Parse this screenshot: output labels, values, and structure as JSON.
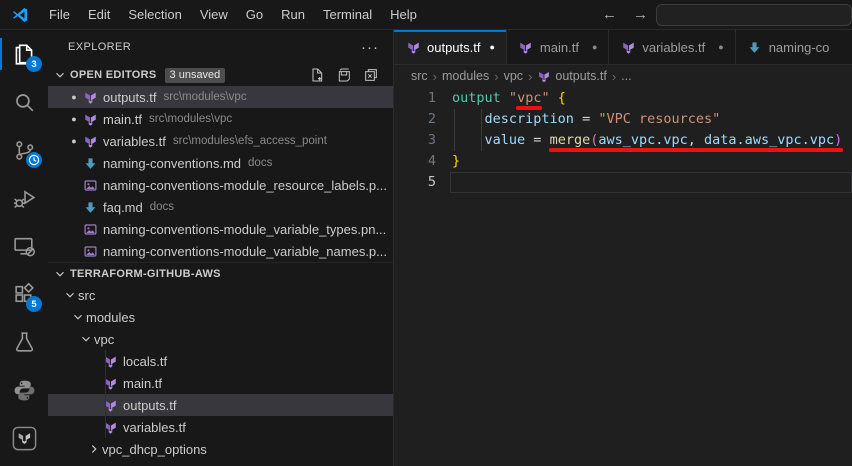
{
  "titlebar": {
    "menus": [
      "File",
      "Edit",
      "Selection",
      "View",
      "Go",
      "Run",
      "Terminal",
      "Help"
    ],
    "back_arrow": "←",
    "forward_arrow": "→",
    "search_value": "",
    "search_placeholder": ""
  },
  "activitybar": {
    "items": [
      {
        "name": "explorer",
        "badge": "3",
        "active": true
      },
      {
        "name": "search",
        "active": false
      },
      {
        "name": "source-control",
        "badge": "clock",
        "active": false
      },
      {
        "name": "run-and-debug",
        "active": false
      },
      {
        "name": "remote-explorer",
        "active": false
      },
      {
        "name": "extensions",
        "badge": "5",
        "active": false
      },
      {
        "name": "testing",
        "active": false
      },
      {
        "name": "python",
        "active": false
      },
      {
        "name": "terraform",
        "active": false
      }
    ]
  },
  "sidebar": {
    "title": "EXPLORER",
    "open_editors": {
      "label": "OPEN EDITORS",
      "badge": "3 unsaved",
      "actions": [
        "new-file",
        "save-all",
        "close-all"
      ],
      "items": [
        {
          "modified": true,
          "icon": "terraform",
          "name": "outputs.tf",
          "path": "src\\modules\\vpc",
          "selected": true
        },
        {
          "modified": true,
          "icon": "terraform",
          "name": "main.tf",
          "path": "src\\modules\\vpc",
          "selected": false
        },
        {
          "modified": true,
          "icon": "terraform",
          "name": "variables.tf",
          "path": "src\\modules\\efs_access_point",
          "selected": false
        },
        {
          "modified": false,
          "icon": "markdown",
          "name": "naming-conventions.md",
          "path": "docs",
          "selected": false
        },
        {
          "modified": false,
          "icon": "image",
          "name": "naming-conventions-module_resource_labels.p...",
          "path": "",
          "selected": false
        },
        {
          "modified": false,
          "icon": "markdown",
          "name": "faq.md",
          "path": "docs",
          "selected": false
        },
        {
          "modified": false,
          "icon": "image",
          "name": "naming-conventions-module_variable_types.pn...",
          "path": "",
          "selected": false
        },
        {
          "modified": false,
          "icon": "image",
          "name": "naming-conventions-module_variable_names.p...",
          "path": "",
          "selected": false
        }
      ]
    },
    "project": {
      "label": "TERRAFORM-GITHUB-AWS",
      "tree": [
        {
          "label": "src",
          "chevron": "down",
          "indent": 14,
          "icon": null,
          "selected": false
        },
        {
          "label": "modules",
          "chevron": "down",
          "indent": 22,
          "icon": null,
          "selected": false
        },
        {
          "label": "vpc",
          "chevron": "down",
          "indent": 30,
          "icon": null,
          "selected": false
        },
        {
          "label": "locals.tf",
          "chevron": null,
          "indent": 54,
          "icon": "terraform",
          "selected": false
        },
        {
          "label": "main.tf",
          "chevron": null,
          "indent": 54,
          "icon": "terraform",
          "selected": false
        },
        {
          "label": "outputs.tf",
          "chevron": null,
          "indent": 54,
          "icon": "terraform",
          "selected": true
        },
        {
          "label": "variables.tf",
          "chevron": null,
          "indent": 54,
          "icon": "terraform",
          "selected": false
        },
        {
          "label": "vpc_dhcp_options",
          "chevron": "right",
          "indent": 38,
          "icon": null,
          "selected": false
        }
      ]
    }
  },
  "editor": {
    "tabs": [
      {
        "icon": "terraform",
        "label": "outputs.tf",
        "dot": true,
        "active": true
      },
      {
        "icon": "terraform",
        "label": "main.tf",
        "dot": true,
        "active": false
      },
      {
        "icon": "terraform",
        "label": "variables.tf",
        "dot": true,
        "active": false
      },
      {
        "icon": "markdown",
        "label": "naming-co",
        "dot": false,
        "active": false
      }
    ],
    "breadcrumb": [
      {
        "label": "src",
        "icon": null
      },
      {
        "label": "modules",
        "icon": null
      },
      {
        "label": "vpc",
        "icon": null
      },
      {
        "label": "outputs.tf",
        "icon": "terraform"
      },
      {
        "label": "...",
        "icon": null
      }
    ],
    "code": {
      "lines": [
        {
          "num": "1",
          "current": false,
          "tokens": [
            [
              "output",
              "type"
            ],
            [
              " ",
              "pl"
            ],
            [
              "\"",
              "str"
            ],
            [
              "vpc",
              "str u"
            ],
            [
              "\"",
              "str"
            ],
            [
              " ",
              "pl"
            ],
            [
              "{",
              "b1"
            ]
          ]
        },
        {
          "num": "2",
          "current": false,
          "tokens": [
            [
              "    ",
              "pl"
            ],
            [
              "description",
              "prop"
            ],
            [
              " ",
              "pl"
            ],
            [
              "=",
              "op"
            ],
            [
              " ",
              "pl"
            ],
            [
              "\"VPC resources\"",
              "str"
            ]
          ]
        },
        {
          "num": "3",
          "current": false,
          "tokens": [
            [
              "    ",
              "pl"
            ],
            [
              "value",
              "prop"
            ],
            [
              " ",
              "pl"
            ],
            [
              "=",
              "op"
            ],
            [
              " ",
              "pl"
            ],
            [
              "merge",
              "fn u"
            ],
            [
              "(",
              "b2 u"
            ],
            [
              "aws_vpc.vpc",
              "prop u"
            ],
            [
              ",",
              "op u"
            ],
            [
              " ",
              "pl u"
            ],
            [
              "data.aws_vpc.vpc",
              "prop u"
            ],
            [
              ")",
              "b2 u"
            ]
          ]
        },
        {
          "num": "4",
          "current": false,
          "tokens": [
            [
              "}",
              "b1"
            ]
          ]
        },
        {
          "num": "5",
          "current": true,
          "tokens": []
        }
      ],
      "annotations": "red underlines on \"vpc\" and merge(aws_vpc.vpc, data.aws_vpc.vpc)"
    }
  },
  "colors": {
    "accent": "#0078d4",
    "red": "#ed1111",
    "tfPurpleDark": "#8a63c4",
    "tfPurpleLight": "#b08ae0",
    "mdBlue": "#519aba",
    "imgPurple": "#9f7cc9",
    "logoBlue": "#1f9cf0",
    "codeType": "#4EC9B0",
    "codeString": "#CE9178",
    "codeProp": "#9CDCFE",
    "codeFn": "#DCDCAA",
    "codeOp": "#d4d4d4",
    "bracket1": "#ffd700",
    "bracket2": "#d670d6",
    "lineNo": "#6e7681",
    "lineNoActive": "#c6c6c6"
  }
}
